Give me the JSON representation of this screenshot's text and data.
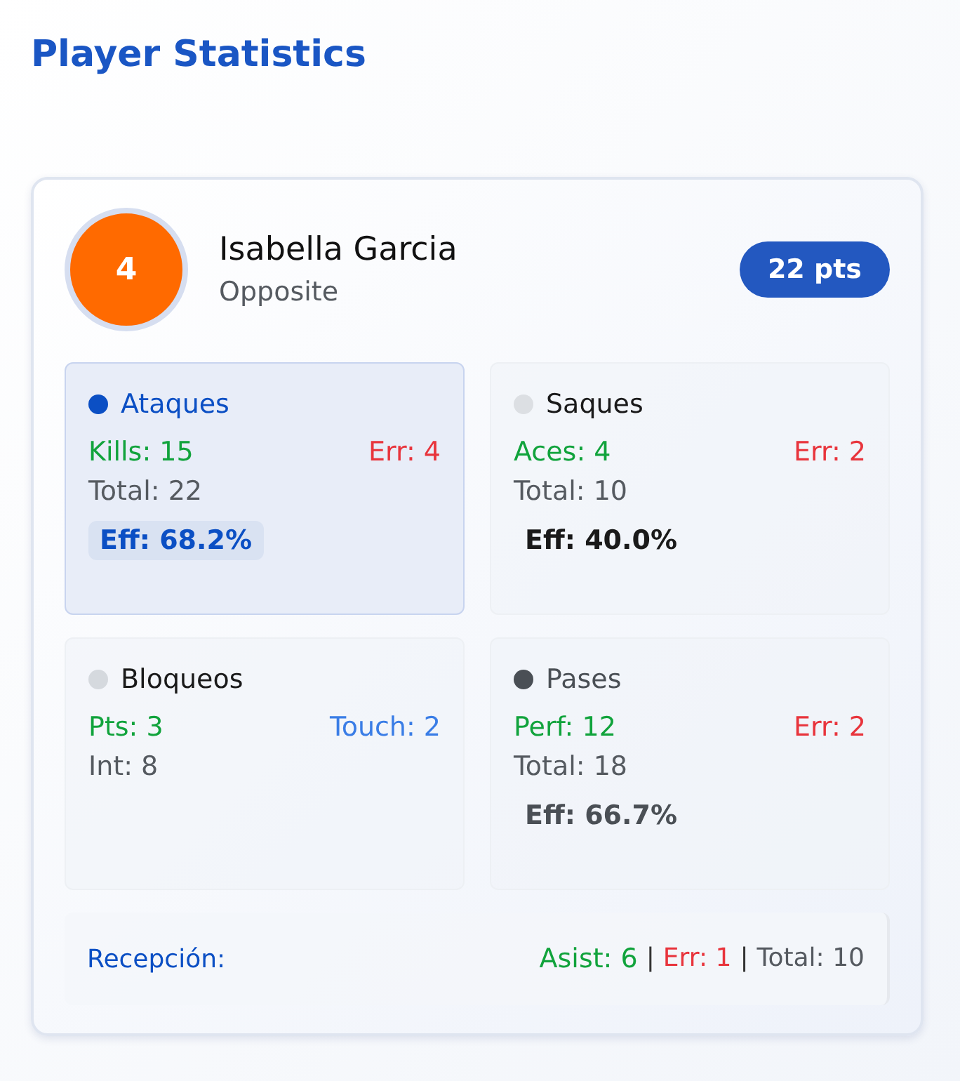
{
  "page_title": "Player Statistics",
  "player": {
    "number": "4",
    "name": "Isabella Garcia",
    "position": "Opposite",
    "points": "22 pts"
  },
  "panels": [
    {
      "name": "Ataques",
      "selected": true,
      "color": "#0b4fc4",
      "positive": "Kills: 15",
      "negative": {
        "kind": "error",
        "text": "Err: 4"
      },
      "total": "Total: 22",
      "efficiency": "Eff: 68.2%"
    },
    {
      "name": "Saques",
      "selected": false,
      "color": "#dcdfe3",
      "positive": "Aces: 4",
      "negative": {
        "kind": "error",
        "text": "Err: 2"
      },
      "total": "Total: 10",
      "efficiency": "Eff: 40.0%"
    },
    {
      "name": "Bloqueos",
      "selected": false,
      "color": "#d5d9de",
      "positive": "Pts: 3",
      "negative": {
        "kind": "touch",
        "text": "Touch: 2"
      },
      "total": "Int: 8"
    },
    {
      "name": "Pases",
      "selected": false,
      "color": "#4a4f55",
      "positive": "Perf: 12",
      "negative": {
        "kind": "error",
        "text": "Err: 2"
      },
      "total": "Total: 18",
      "efficiency": "Eff: 66.7%"
    }
  ],
  "reception": {
    "label": "Recepción:",
    "parts": [
      {
        "kind": "positive",
        "text": "Asist: 6"
      },
      {
        "kind": "separator",
        "text": "|"
      },
      {
        "kind": "error",
        "text": "Err: 1"
      },
      {
        "kind": "separator",
        "text": "|"
      },
      {
        "kind": "total",
        "text": "Total: 10"
      }
    ]
  }
}
